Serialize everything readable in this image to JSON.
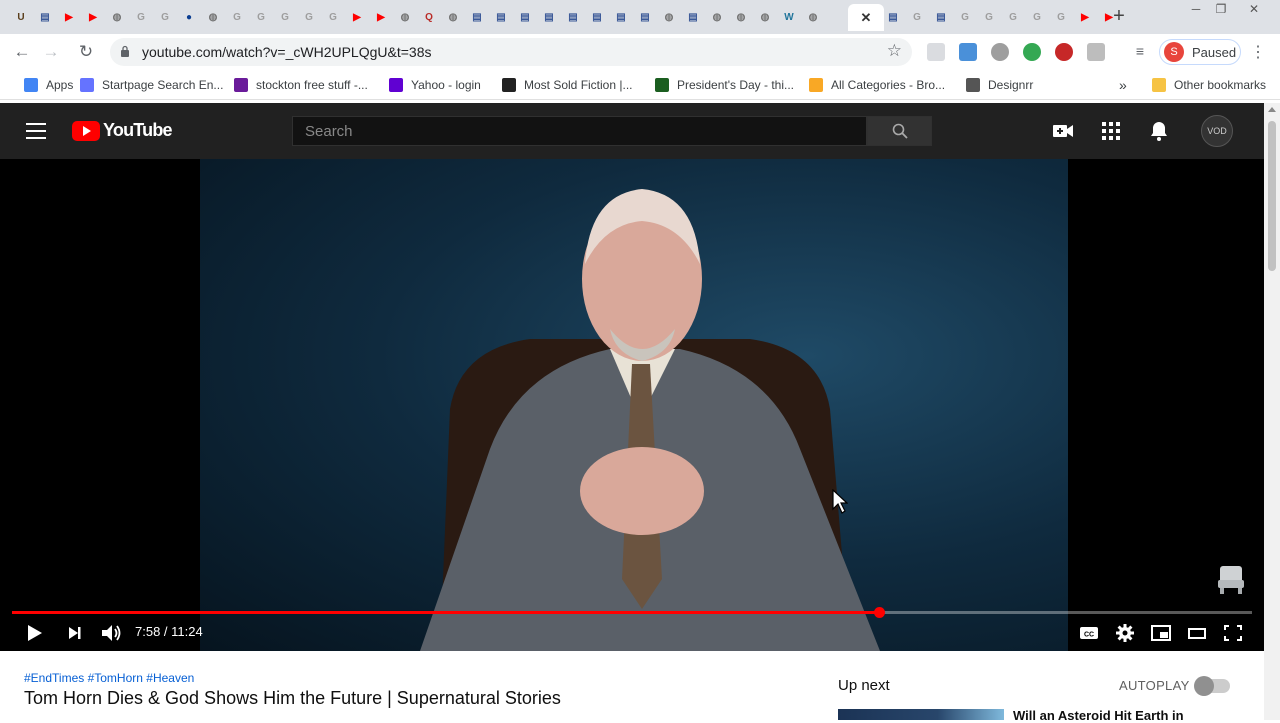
{
  "browser": {
    "tabs": [
      {
        "icon": "ups-icon",
        "glyph": "U",
        "color": "#5a3e1b"
      },
      {
        "icon": "page-icon",
        "glyph": "▤",
        "color": "#3b5998"
      },
      {
        "icon": "youtube-icon",
        "glyph": "▶",
        "color": "#ff0000"
      },
      {
        "icon": "youtube-icon",
        "glyph": "▶",
        "color": "#ff0000"
      },
      {
        "icon": "globe-icon",
        "glyph": "◍",
        "color": "#757575"
      },
      {
        "icon": "google-icon",
        "glyph": "G",
        "color": "#9e9e9e"
      },
      {
        "icon": "google-icon",
        "glyph": "G",
        "color": "#9e9e9e"
      },
      {
        "icon": "nasa-icon",
        "glyph": "●",
        "color": "#0b3d91"
      },
      {
        "icon": "globe-icon",
        "glyph": "◍",
        "color": "#757575"
      },
      {
        "icon": "google-icon",
        "glyph": "G",
        "color": "#9e9e9e"
      },
      {
        "icon": "google-icon",
        "glyph": "G",
        "color": "#9e9e9e"
      },
      {
        "icon": "google-icon",
        "glyph": "G",
        "color": "#9e9e9e"
      },
      {
        "icon": "google-icon",
        "glyph": "G",
        "color": "#9e9e9e"
      },
      {
        "icon": "google-icon",
        "glyph": "G",
        "color": "#9e9e9e"
      },
      {
        "icon": "youtube-icon",
        "glyph": "▶",
        "color": "#ff0000"
      },
      {
        "icon": "youtube-icon",
        "glyph": "▶",
        "color": "#ff0000"
      },
      {
        "icon": "globe-icon",
        "glyph": "◍",
        "color": "#757575"
      },
      {
        "icon": "quora-icon",
        "glyph": "Q",
        "color": "#b92b27"
      },
      {
        "icon": "globe-icon",
        "glyph": "◍",
        "color": "#757575"
      },
      {
        "icon": "page-icon",
        "glyph": "▤",
        "color": "#3b5998"
      },
      {
        "icon": "page-icon",
        "glyph": "▤",
        "color": "#3b5998"
      },
      {
        "icon": "page-icon",
        "glyph": "▤",
        "color": "#3b5998"
      },
      {
        "icon": "page-icon",
        "glyph": "▤",
        "color": "#3b5998"
      },
      {
        "icon": "page-icon",
        "glyph": "▤",
        "color": "#3b5998"
      },
      {
        "icon": "page-icon",
        "glyph": "▤",
        "color": "#3b5998"
      },
      {
        "icon": "page-icon",
        "glyph": "▤",
        "color": "#3b5998"
      },
      {
        "icon": "page-icon",
        "glyph": "▤",
        "color": "#3b5998"
      },
      {
        "icon": "globe-icon",
        "glyph": "◍",
        "color": "#757575"
      },
      {
        "icon": "page-icon",
        "glyph": "▤",
        "color": "#3b5998"
      },
      {
        "icon": "globe-icon",
        "glyph": "◍",
        "color": "#757575"
      },
      {
        "icon": "globe-icon",
        "glyph": "◍",
        "color": "#757575"
      },
      {
        "icon": "globe-icon",
        "glyph": "◍",
        "color": "#757575"
      },
      {
        "icon": "wordpress-icon",
        "glyph": "W",
        "color": "#21759b"
      },
      {
        "icon": "globe-icon",
        "glyph": "◍",
        "color": "#757575"
      }
    ],
    "tabs_after": [
      {
        "icon": "page-icon",
        "glyph": "▤",
        "color": "#3b5998"
      },
      {
        "icon": "google-icon",
        "glyph": "G",
        "color": "#9e9e9e"
      },
      {
        "icon": "page-icon",
        "glyph": "▤",
        "color": "#3b5998"
      },
      {
        "icon": "google-icon",
        "glyph": "G",
        "color": "#9e9e9e"
      },
      {
        "icon": "google-icon",
        "glyph": "G",
        "color": "#9e9e9e"
      },
      {
        "icon": "google-icon",
        "glyph": "G",
        "color": "#9e9e9e"
      },
      {
        "icon": "google-icon",
        "glyph": "G",
        "color": "#9e9e9e"
      },
      {
        "icon": "google-icon",
        "glyph": "G",
        "color": "#9e9e9e"
      },
      {
        "icon": "youtube-icon",
        "glyph": "▶",
        "color": "#ff0000"
      },
      {
        "icon": "youtube-icon",
        "glyph": "▶",
        "color": "#ff0000"
      }
    ],
    "active_tab_close": "✕",
    "new_tab": "+",
    "url": "youtube.com/watch?v=_cWH2UPLQgU&t=38s",
    "profile_initial": "S",
    "profile_label": "Paused",
    "bookmarks": [
      {
        "label": "Apps",
        "color": "#4285f4"
      },
      {
        "label": "Startpage Search En...",
        "color": "#6573ff"
      },
      {
        "label": "stockton free stuff -...",
        "color": "#6a1b9a"
      },
      {
        "label": "Yahoo - login",
        "color": "#6001d2"
      },
      {
        "label": "Most Sold Fiction |...",
        "color": "#222222"
      },
      {
        "label": "President's Day - thi...",
        "color": "#1b5e20"
      },
      {
        "label": "All Categories - Bro...",
        "color": "#f9a825"
      },
      {
        "label": "Designrr",
        "color": "#555555"
      }
    ],
    "bookmarks_more": "»",
    "other_bookmarks": "Other bookmarks"
  },
  "youtube": {
    "logo_text": "YouTube",
    "search_placeholder": "Search",
    "avatar_text": "VOD",
    "player": {
      "time_current": "7:58",
      "time_total": "11:24",
      "time_display": "7:58 / 11:24",
      "progress": 0.699
    },
    "hashtags": "#EndTimes #TomHorn #Heaven",
    "title": "Tom Horn Dies & God Shows Him the Future | Supernatural Stories",
    "up_next_label": "Up next",
    "autoplay_label": "AUTOPLAY",
    "next_video_title": "Will an Asteroid Hit Earth in"
  },
  "colors": {
    "yt_red": "#ff0000",
    "header_bg": "#212121",
    "link_blue": "#065fd4"
  }
}
